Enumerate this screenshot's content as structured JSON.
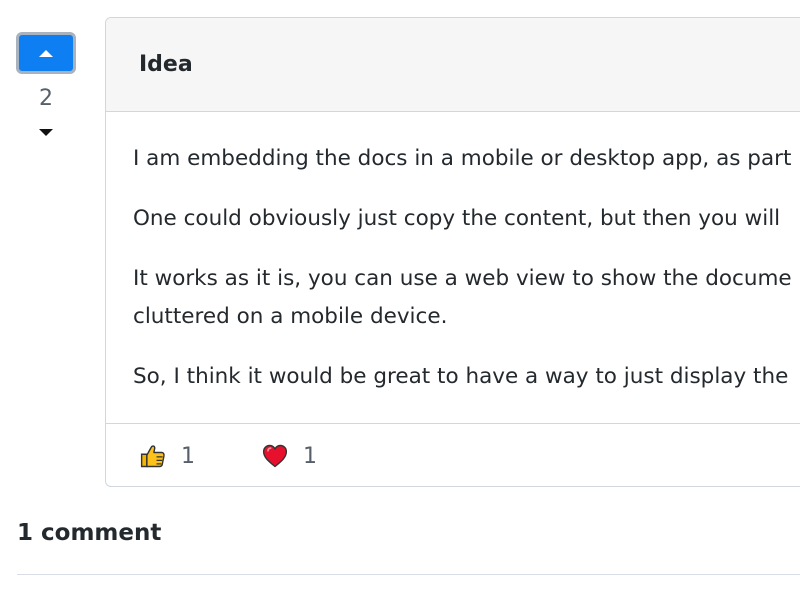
{
  "vote": {
    "count": "2"
  },
  "discussion": {
    "category": "Idea",
    "paragraphs": [
      "I am embedding the docs in a mobile or desktop app, as part",
      "One could obviously just copy the content, but then you will",
      "So, I think it would be great to have a way to just display the"
    ],
    "wrapped_paragraph": {
      "line1": "It works as it is, you can use a web view to show the docume",
      "line2": "cluttered on a mobile device."
    },
    "reactions": [
      {
        "icon": "thumbs-up-icon",
        "count": "1"
      },
      {
        "icon": "heart-icon",
        "count": "1"
      }
    ]
  },
  "comments": {
    "heading": "1 comment"
  },
  "colors": {
    "upvote_bg": "#0d7ff2",
    "card_border": "#d0d7de",
    "header_bg": "#f6f6f6"
  }
}
